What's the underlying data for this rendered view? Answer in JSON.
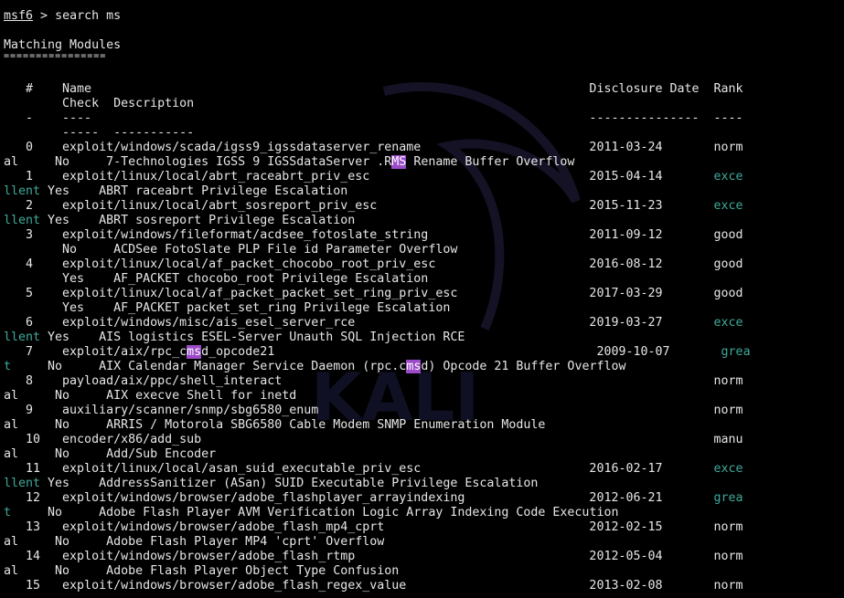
{
  "colors": {
    "background": "#000000",
    "foreground": "#e6e6e6",
    "rank_highlight": "#3fa99a",
    "match_highlight": "#9b4bc7"
  },
  "prompt": {
    "name": "msf6",
    "symbol": " > ",
    "command": "search ms"
  },
  "section_title": "Matching Modules",
  "section_underline": "================",
  "headers": {
    "row1": "   #    Name                                                                    Disclosure Date  Rank",
    "row2": "        Check  Description",
    "row3": "   -    ----                                                                    ---------------  ----",
    "row4": "        -----  -----------"
  },
  "rows": [
    {
      "line1": "   0    exploit/windows/scada/igss9_igssdataserver_rename                       2011-03-24       ",
      "line1_hl": "",
      "line1_post": "",
      "rank": "norm",
      "rank_class": "rank-normal",
      "cont": "al",
      "cont_class": "rank-normal",
      "line2": "     No     7-Technologies IGSS 9 IGSSdataServer .R",
      "line2_hl": "MS",
      "line2_post": " Rename Buffer Overflow"
    },
    {
      "line1": "   1    exploit/linux/local/abrt_raceabrt_priv_esc                              2015-04-14       ",
      "line1_hl": "",
      "line1_post": "",
      "rank": "exce",
      "rank_class": "rank-excellent",
      "cont": "llent",
      "cont_class": "rank-excellent",
      "line2": " Yes    ABRT raceabrt Privilege Escalation",
      "line2_hl": "",
      "line2_post": ""
    },
    {
      "line1": "   2    exploit/linux/local/abrt_sosreport_priv_esc                             2015-11-23       ",
      "line1_hl": "",
      "line1_post": "",
      "rank": "exce",
      "rank_class": "rank-excellent",
      "cont": "llent",
      "cont_class": "rank-excellent",
      "line2": " Yes    ABRT sosreport Privilege Escalation",
      "line2_hl": "",
      "line2_post": ""
    },
    {
      "line1": "   3    exploit/windows/fileformat/acdsee_fotoslate_string                      2011-09-12       ",
      "line1_hl": "",
      "line1_post": "",
      "rank": "good",
      "rank_class": "rank-good",
      "cont": "",
      "cont_class": "rank-good",
      "line2": "        No     ACDSee FotoSlate PLP File id Parameter Overflow",
      "line2_hl": "",
      "line2_post": ""
    },
    {
      "line1": "   4    exploit/linux/local/af_packet_chocobo_root_priv_esc                     2016-08-12       ",
      "line1_hl": "",
      "line1_post": "",
      "rank": "good",
      "rank_class": "rank-good",
      "cont": "",
      "cont_class": "rank-good",
      "line2": "        Yes    AF_PACKET chocobo_root Privilege Escalation",
      "line2_hl": "",
      "line2_post": ""
    },
    {
      "line1": "   5    exploit/linux/local/af_packet_packet_set_ring_priv_esc                  2017-03-29       ",
      "line1_hl": "",
      "line1_post": "",
      "rank": "good",
      "rank_class": "rank-good",
      "cont": "",
      "cont_class": "rank-good",
      "line2": "        Yes    AF_PACKET packet_set_ring Privilege Escalation",
      "line2_hl": "",
      "line2_post": ""
    },
    {
      "line1": "   6    exploit/windows/misc/ais_esel_server_rce                                2019-03-27       ",
      "line1_hl": "",
      "line1_post": "",
      "rank": "exce",
      "rank_class": "rank-excellent",
      "cont": "llent",
      "cont_class": "rank-excellent",
      "line2": " Yes    AIS logistics ESEL-Server Unauth SQL Injection RCE",
      "line2_hl": "",
      "line2_post": ""
    },
    {
      "line1": "   7    exploit/aix/rpc_c",
      "line1_hl": "ms",
      "line1_post": "d_opcode21                                            2009-10-07       ",
      "rank": "grea",
      "rank_class": "rank-great",
      "cont": "t",
      "cont_class": "rank-great",
      "line2": "     No     AIX Calendar Manager Service Daemon (rpc.c",
      "line2_hl": "ms",
      "line2_post": "d) Opcode 21 Buffer Overflow"
    },
    {
      "line1": "   8    payload/aix/ppc/shell_interact                                                           ",
      "line1_hl": "",
      "line1_post": "",
      "rank": "norm",
      "rank_class": "rank-normal",
      "cont": "al",
      "cont_class": "rank-normal",
      "line2": "     No     AIX execve Shell for inetd",
      "line2_hl": "",
      "line2_post": ""
    },
    {
      "line1": "   9    auxiliary/scanner/snmp/sbg6580_enum                                                      ",
      "line1_hl": "",
      "line1_post": "",
      "rank": "norm",
      "rank_class": "rank-normal",
      "cont": "al",
      "cont_class": "rank-normal",
      "line2": "     No     ARRIS / Motorola SBG6580 Cable Modem SNMP Enumeration Module",
      "line2_hl": "",
      "line2_post": ""
    },
    {
      "line1": "   10   encoder/x86/add_sub                                                                      ",
      "line1_hl": "",
      "line1_post": "",
      "rank": "manu",
      "rank_class": "rank-manual",
      "cont": "al",
      "cont_class": "rank-manual",
      "line2": "     No     Add/Sub Encoder",
      "line2_hl": "",
      "line2_post": ""
    },
    {
      "line1": "   11   exploit/linux/local/asan_suid_executable_priv_esc                       2016-02-17       ",
      "line1_hl": "",
      "line1_post": "",
      "rank": "exce",
      "rank_class": "rank-excellent",
      "cont": "llent",
      "cont_class": "rank-excellent",
      "line2": " Yes    AddressSanitizer (ASan) SUID Executable Privilege Escalation",
      "line2_hl": "",
      "line2_post": ""
    },
    {
      "line1": "   12   exploit/windows/browser/adobe_flashplayer_arrayindexing                 2012-06-21       ",
      "line1_hl": "",
      "line1_post": "",
      "rank": "grea",
      "rank_class": "rank-great",
      "cont": "t",
      "cont_class": "rank-great",
      "line2": "     No     Adobe Flash Player AVM Verification Logic Array Indexing Code Execution",
      "line2_hl": "",
      "line2_post": ""
    },
    {
      "line1": "   13   exploit/windows/browser/adobe_flash_mp4_cprt                            2012-02-15       ",
      "line1_hl": "",
      "line1_post": "",
      "rank": "norm",
      "rank_class": "rank-normal",
      "cont": "al",
      "cont_class": "rank-normal",
      "line2": "     No     Adobe Flash Player MP4 'cprt' Overflow",
      "line2_hl": "",
      "line2_post": ""
    },
    {
      "line1": "   14   exploit/windows/browser/adobe_flash_rtmp                                2012-05-04       ",
      "line1_hl": "",
      "line1_post": "",
      "rank": "norm",
      "rank_class": "rank-normal",
      "cont": "al",
      "cont_class": "rank-normal",
      "line2": "     No     Adobe Flash Player Object Type Confusion",
      "line2_hl": "",
      "line2_post": ""
    },
    {
      "line1": "   15   exploit/windows/browser/adobe_flash_regex_value                         2013-02-08       ",
      "line1_hl": "",
      "line1_post": "",
      "rank": "norm",
      "rank_class": "rank-normal",
      "cont": "",
      "cont_class": "rank-normal",
      "line2": "",
      "line2_hl": "",
      "line2_post": ""
    }
  ]
}
